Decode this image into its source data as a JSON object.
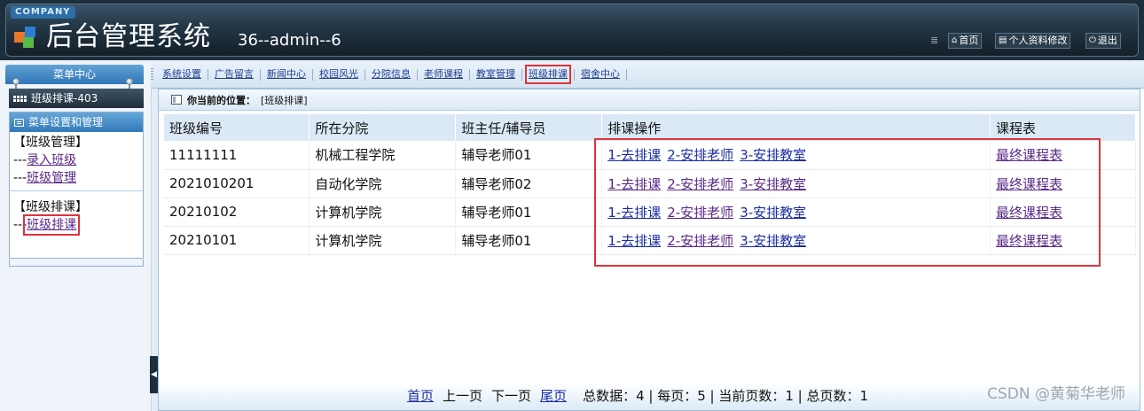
{
  "header": {
    "company": "COMPANY",
    "app_title": "后台管理系统",
    "user_info": "36--admin--6",
    "buttons": [
      {
        "label": "首页",
        "icon": "home-icon"
      },
      {
        "label": "个人资料修改",
        "icon": "profile-icon"
      },
      {
        "label": "退出",
        "icon": "power-icon"
      }
    ]
  },
  "nav": {
    "items": [
      "系统设置",
      "广告留言",
      "新闻中心",
      "校园风光",
      "分院信息",
      "老师课程",
      "教室管理",
      "班级排课",
      "宿舍中心"
    ],
    "active": "班级排课"
  },
  "sidebar": {
    "menu_title": "菜单中心",
    "module": "班级排课-403",
    "box_title": "菜单设置和管理",
    "groups": [
      {
        "title": "【班级管理】",
        "links": [
          "录入班级",
          "班级管理"
        ]
      },
      {
        "title": "【班级排课】",
        "links": [
          "班级排课"
        ]
      }
    ],
    "link_prefix": "---"
  },
  "breadcrumb": {
    "label": "你当前的位置：",
    "value": "[班级排课]"
  },
  "table": {
    "headers": [
      "班级编号",
      "所在分院",
      "班主任/辅导员",
      "排课操作",
      "课程表"
    ],
    "actions": [
      "1-去排课",
      "2-安排老师",
      "3-安排教室"
    ],
    "schedule_link": "最终课程表",
    "rows": [
      {
        "id": "11111111",
        "college": "机械工程学院",
        "counselor": "辅导老师01"
      },
      {
        "id": "2021010201",
        "college": "自动化学院",
        "counselor": "辅导老师02"
      },
      {
        "id": "20210102",
        "college": "计算机学院",
        "counselor": "辅导老师01"
      },
      {
        "id": "20210101",
        "college": "计算机学院",
        "counselor": "辅导老师01"
      }
    ]
  },
  "pager": {
    "first": "首页",
    "prev": "上一页",
    "next": "下一页",
    "last": "尾页",
    "stats": "总数据：4 | 每页：5 | 当前页数：1 | 总页数：1"
  },
  "watermark": "CSDN @黄菊华老师",
  "colors": {
    "accent": "#2f76b6",
    "highlight": "#e0323a",
    "link": "#1c2da6"
  }
}
